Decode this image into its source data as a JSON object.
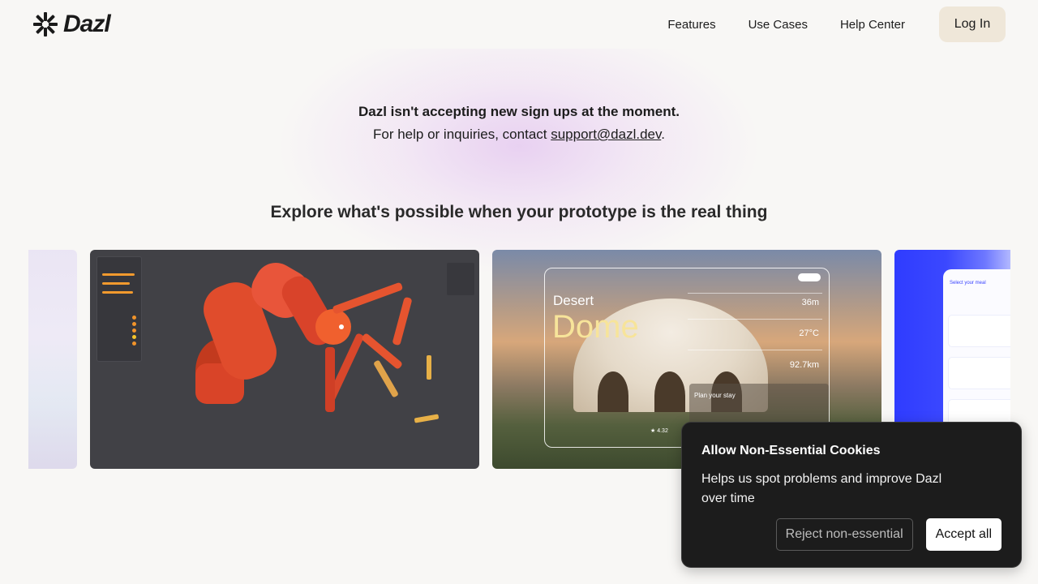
{
  "header": {
    "brand": "Dazl",
    "nav": [
      {
        "label": "Features"
      },
      {
        "label": "Use Cases"
      },
      {
        "label": "Help Center"
      }
    ],
    "login_label": "Log In"
  },
  "notice": {
    "title": "Dazl isn't accepting new sign ups at the moment.",
    "sub_prefix": "For help or inquiries, contact ",
    "email": "support@dazl.dev",
    "sub_suffix": "."
  },
  "explore": {
    "heading": "Explore what's possible when your prototype is the real thing"
  },
  "showcase": {
    "desert": {
      "title_line1": "Desert",
      "title_line2": "Dome",
      "stats": [
        {
          "value": "36m"
        },
        {
          "value": "27°C"
        },
        {
          "value": "92.7km"
        }
      ],
      "plan_title": "Plan your stay",
      "rating": "★ 4.32"
    },
    "blue": {
      "title": "Select your meal"
    }
  },
  "cookie": {
    "title": "Allow Non-Essential Cookies",
    "text": "Helps us spot problems and improve Dazl over time",
    "reject_label": "Reject non-essential",
    "accept_label": "Accept all"
  },
  "colors": {
    "background": "#f8f7f5",
    "login_bg": "#efe7d9",
    "cookie_bg": "#1c1c1c",
    "accent_gold": "#f7e49a",
    "blue_card": "#2f3cff"
  }
}
